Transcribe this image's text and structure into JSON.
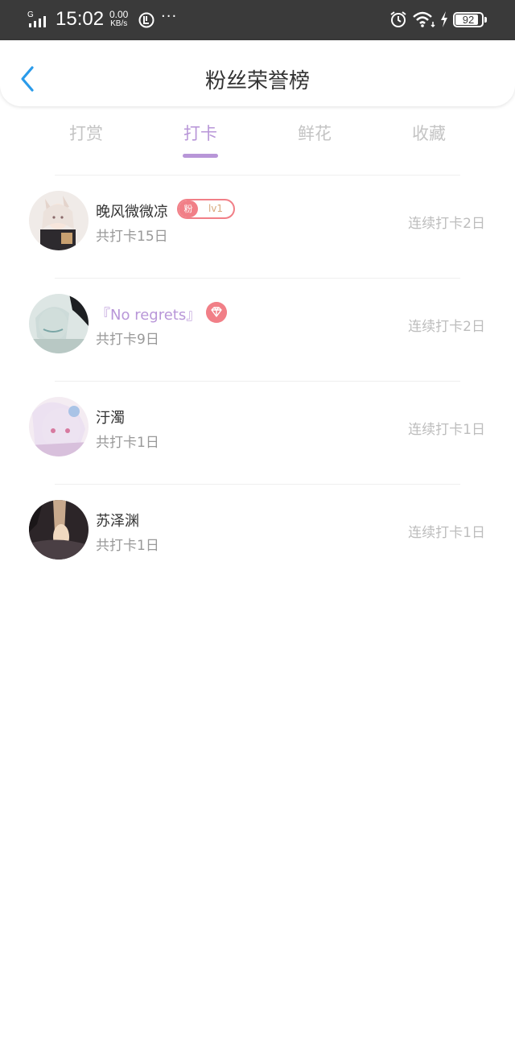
{
  "status_bar": {
    "network": "G",
    "time": "15:02",
    "speed_value": "0.00",
    "speed_unit": "KB/s",
    "more": "···",
    "battery": "92"
  },
  "header": {
    "title": "粉丝荣誉榜"
  },
  "tabs": [
    {
      "label": "打赏",
      "active": false
    },
    {
      "label": "打卡",
      "active": true
    },
    {
      "label": "鲜花",
      "active": false
    },
    {
      "label": "收藏",
      "active": false
    }
  ],
  "rows": [
    {
      "name": "晚风微微凉",
      "badge_left": "粉",
      "badge_right": "lv1",
      "total": "共打卡15日",
      "streak": "连续打卡2日"
    },
    {
      "name": "『No regrets』",
      "total": "共打卡9日",
      "streak": "连续打卡2日"
    },
    {
      "name": "汙濁",
      "total": "共打卡1日",
      "streak": "连续打卡1日"
    },
    {
      "name": "苏泽渊",
      "total": "共打卡1日",
      "streak": "连续打卡1日"
    }
  ],
  "colors": {
    "accent": "#b896d8",
    "badge": "#f17f87",
    "status_bar": "#3a3a3a"
  }
}
